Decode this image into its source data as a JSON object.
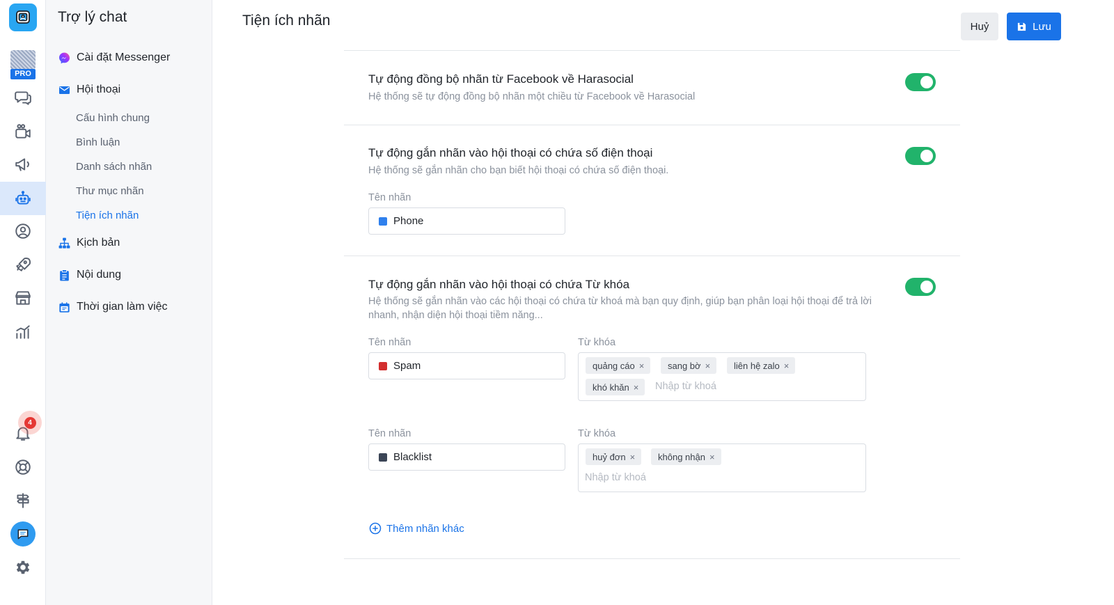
{
  "rail": {
    "pro_badge": "PRO",
    "notification_count": "4"
  },
  "sidebar": {
    "title": "Trợ lý chat",
    "messenger": "Cài đặt Messenger",
    "conversation": "Hội thoại",
    "sub_items": [
      "Cấu hình chung",
      "Bình luận",
      "Danh sách nhãn",
      "Thư mục nhãn",
      "Tiện ích nhãn"
    ],
    "script": "Kịch bản",
    "content": "Nội dung",
    "working_time": "Thời gian làm việc"
  },
  "header": {
    "title": "Tiện ích nhãn",
    "cancel_label": "Huỷ",
    "save_label": "Lưu"
  },
  "sections": [
    {
      "title": "Tự động đồng bộ nhãn từ Facebook về Harasocial",
      "desc": "Hệ thống sẽ tự động đồng bộ nhãn một chiều từ Facebook về Harasocial",
      "enabled": true
    },
    {
      "title": "Tự động gắn nhãn vào hội thoại có chứa số điện thoại",
      "desc": "Hệ thống sẽ gắn nhãn cho bạn biết hội thoại có chứa số điện thoại.",
      "enabled": true,
      "label_field": "Tên nhãn",
      "label_value": "Phone",
      "label_color": "#2f80ed"
    },
    {
      "title": "Tự động gắn nhãn vào hội thoại có chứa Từ khóa",
      "desc_line1": "Hệ thống sẽ gắn nhãn vào các hội thoại có chứa từ khoá mà bạn quy định, giúp bạn phân loại hội thoại để trả lời",
      "desc_line2": "nhanh, nhận diện hội thoại tiềm năng...",
      "enabled": true,
      "rules": [
        {
          "label_field": "Tên nhãn",
          "label_value": "Spam",
          "label_color": "#d32f2f",
          "keyword_field": "Từ khóa",
          "keywords": [
            "quảng cáo",
            "sang bờ",
            "liên hệ zalo",
            "khó khăn"
          ],
          "keyword_placeholder": "Nhập từ khoá"
        },
        {
          "label_field": "Tên nhãn",
          "label_value": "Blacklist",
          "label_color": "#3b4556",
          "keyword_field": "Từ khóa",
          "keywords": [
            "huỷ đơn",
            "không nhận"
          ],
          "keyword_placeholder": "Nhập từ khoá"
        }
      ],
      "add_more": "Thêm nhãn khác"
    }
  ]
}
